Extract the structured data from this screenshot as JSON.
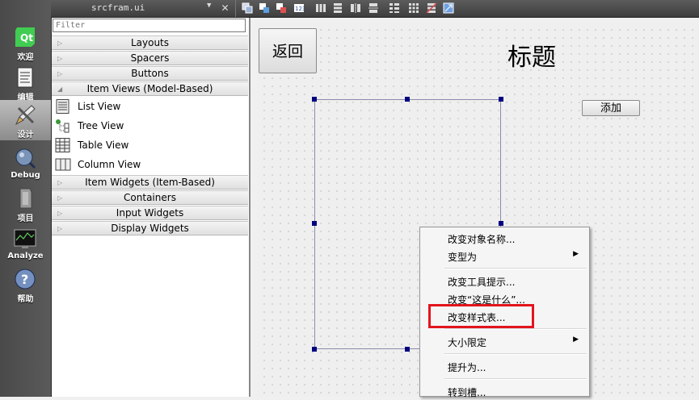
{
  "toolbar": {
    "file_name": "srcfram.ui",
    "icons": [
      "edit-widgets-icon",
      "edit-signals-icon",
      "edit-buddies-icon",
      "edit-tab-order-icon",
      "layout-horizontal-icon",
      "layout-vertical-icon",
      "layout-horizontal-splitter-icon",
      "layout-vertical-splitter-icon",
      "layout-form-icon",
      "layout-grid-icon",
      "break-layout-icon",
      "adjust-size-icon"
    ]
  },
  "modes": [
    {
      "label": "欢迎",
      "icon": "qt-logo-icon"
    },
    {
      "label": "编辑",
      "icon": "edit-document-icon"
    },
    {
      "label": "设计",
      "icon": "design-pencil-icon",
      "active": true
    },
    {
      "label": "Debug",
      "icon": "debug-bug-icon"
    },
    {
      "label": "项目",
      "icon": "project-wrench-icon"
    },
    {
      "label": "Analyze",
      "icon": "analyze-monitor-icon"
    },
    {
      "label": "帮助",
      "icon": "help-icon"
    }
  ],
  "widgetbox": {
    "filter_placeholder": "Filter",
    "categories_top": [
      "Layouts",
      "Spacers",
      "Buttons"
    ],
    "expanded_category": "Item Views (Model-Based)",
    "items": [
      "List View",
      "Tree View",
      "Table View",
      "Column View"
    ],
    "categories_bottom": [
      "Item Widgets (Item-Based)",
      "Containers",
      "Input Widgets",
      "Display Widgets"
    ]
  },
  "form": {
    "back_button": "返回",
    "title": "标题",
    "add_button": "添加"
  },
  "context_menu": {
    "items": [
      {
        "label": "改变对象名称...",
        "submenu": false
      },
      {
        "label": "变型为",
        "submenu": true
      },
      {
        "label": "改变工具提示...",
        "submenu": false
      },
      {
        "label": "改变“这是什么”...",
        "submenu": false
      },
      {
        "label": "改变样式表...",
        "submenu": false,
        "highlighted": true
      },
      {
        "label": "大小限定",
        "submenu": true
      },
      {
        "label": "提升为...",
        "submenu": false
      },
      {
        "label": "转到槽...",
        "submenu": false
      }
    ]
  },
  "colors": {
    "highlight_border": "#e3141c",
    "selection_handle": "#000080"
  }
}
